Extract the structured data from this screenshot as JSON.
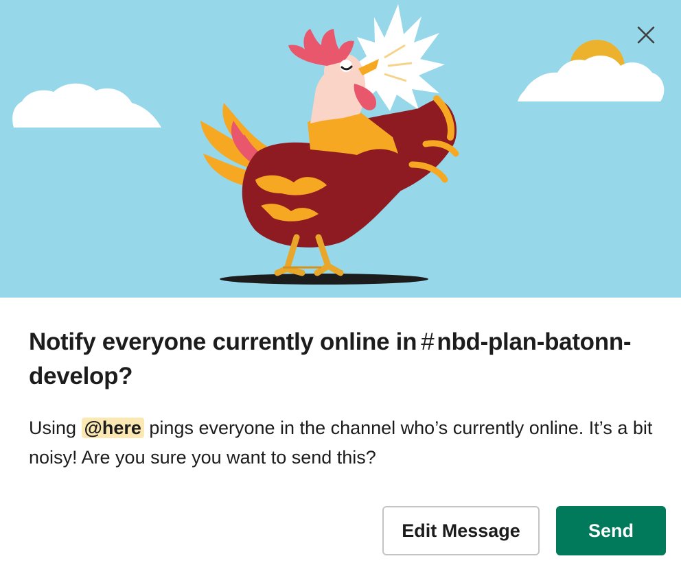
{
  "dialog": {
    "title_prefix": "Notify everyone currently online in",
    "channel_hash": "#",
    "channel_name": "nbd-plan-batonn-develop",
    "title_suffix": "?",
    "message_before": "Using ",
    "mention": "@here",
    "message_after": " pings everyone in the channel who’s currently online. It’s a bit noisy! Are you sure you want to send this?",
    "edit_label": "Edit Message",
    "send_label": "Send",
    "illustration": "rooster-crowing",
    "close_icon": "close-icon"
  },
  "colors": {
    "sky": "#96d8e9",
    "send_button": "#007a5a",
    "mention_highlight": "#fbe8b3"
  }
}
